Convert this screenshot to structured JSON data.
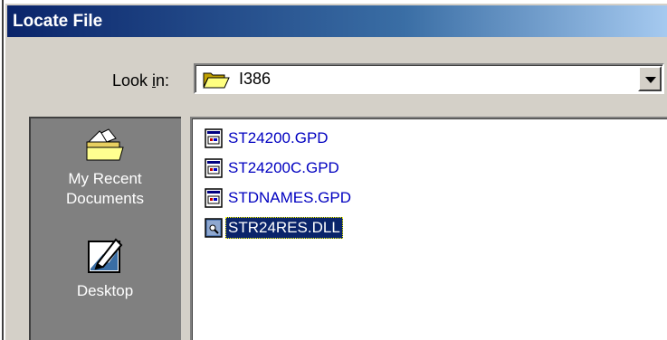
{
  "window": {
    "title": "Locate File"
  },
  "lookin": {
    "label_pre": "Look ",
    "label_accel": "i",
    "label_post": "n:",
    "value": "I386",
    "icon": "folder-open-icon"
  },
  "places": [
    {
      "label_line1": "My Recent",
      "label_line2": "Documents",
      "icon": "recent-documents-icon"
    },
    {
      "label_line1": "Desktop",
      "icon": "desktop-icon"
    }
  ],
  "files": [
    {
      "name": "ST24200.GPD",
      "icon": "gpd-file-icon",
      "selected": false
    },
    {
      "name": "ST24200C.GPD",
      "icon": "gpd-file-icon",
      "selected": false
    },
    {
      "name": "STDNAMES.GPD",
      "icon": "gpd-file-icon",
      "selected": false
    },
    {
      "name": "STR24RES.DLL",
      "icon": "dll-file-icon",
      "selected": true
    }
  ],
  "colors": {
    "title_gradient_start": "#0a246a",
    "title_gradient_end": "#a6caf0",
    "dialog_face": "#d4d0c8",
    "places_bar": "#808080",
    "file_text": "#0000c0",
    "selection": "#0a246a"
  }
}
